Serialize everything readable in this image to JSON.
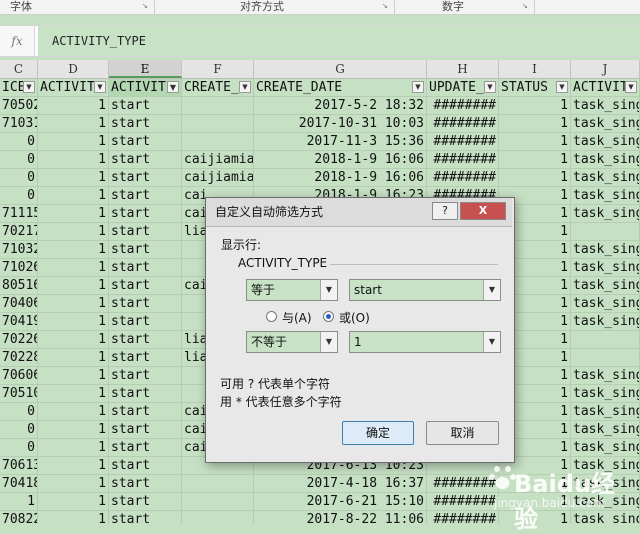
{
  "ribbon": {
    "font_group": "字体",
    "align_group": "对齐方式",
    "number_group": "数字"
  },
  "formula_bar": {
    "fx_label": "fx",
    "content": "ACTIVITY_TYPE"
  },
  "columns": [
    "C",
    "D",
    "E",
    "F",
    "G",
    "H",
    "I",
    "J"
  ],
  "selected_column": "E",
  "header_row": [
    "ICE",
    "ACTIVIT",
    "ACTIVIT",
    "CREATE_",
    "CREATE_DATE",
    "UPDATE_",
    "STATUS",
    "ACTIVIT"
  ],
  "rows": [
    [
      "70502",
      "1",
      "start",
      "",
      "2017-5-2 18:32",
      "########",
      "1",
      "task_sing"
    ],
    [
      "71031",
      "1",
      "start",
      "",
      "2017-10-31 10:03",
      "########",
      "1",
      "task_sing"
    ],
    [
      "0",
      "1",
      "start",
      "",
      "2017-11-3 15:36",
      "########",
      "1",
      "task_sing"
    ],
    [
      "0",
      "1",
      "start",
      "caijiamia",
      "2018-1-9 16:06",
      "########",
      "1",
      "task_sing"
    ],
    [
      "0",
      "1",
      "start",
      "caijiamia",
      "2018-1-9 16:06",
      "########",
      "1",
      "task_sing"
    ],
    [
      "0",
      "1",
      "start",
      "cai",
      "2018-1-9 16:23",
      "########",
      "1",
      "task_sing"
    ],
    [
      "71115",
      "1",
      "start",
      "cai",
      "",
      "",
      "1",
      "task_sing"
    ],
    [
      "70217",
      "1",
      "start",
      "lia",
      "",
      "",
      "1",
      ""
    ],
    [
      "71032",
      "1",
      "start",
      "",
      "",
      "",
      "1",
      "task_sing"
    ],
    [
      "71026",
      "1",
      "start",
      "",
      "",
      "",
      "1",
      "task_sing"
    ],
    [
      "80516",
      "1",
      "start",
      "cai",
      "",
      "",
      "1",
      "task_sing"
    ],
    [
      "70406",
      "1",
      "start",
      "",
      "",
      "",
      "1",
      "task_sing"
    ],
    [
      "70419",
      "1",
      "start",
      "",
      "",
      "",
      "1",
      "task_sing"
    ],
    [
      "70226",
      "1",
      "start",
      "lia",
      "",
      "",
      "1",
      ""
    ],
    [
      "70228",
      "1",
      "start",
      "lia",
      "",
      "",
      "1",
      ""
    ],
    [
      "70606",
      "1",
      "start",
      "",
      "",
      "",
      "1",
      "task_sing"
    ],
    [
      "70510",
      "1",
      "start",
      "",
      "",
      "",
      "1",
      "task_sing"
    ],
    [
      "0",
      "1",
      "start",
      "cai",
      "",
      "",
      "1",
      "task_sing"
    ],
    [
      "0",
      "1",
      "start",
      "cai",
      "",
      "",
      "1",
      "task_sing"
    ],
    [
      "0",
      "1",
      "start",
      "cai",
      "",
      "",
      "1",
      "task_sing"
    ],
    [
      "70613",
      "1",
      "start",
      "",
      "2017-6-13 10:23",
      "",
      "1",
      "task_sing"
    ],
    [
      "70418",
      "1",
      "start",
      "",
      "2017-4-18 16:37",
      "########",
      "1",
      "task_sing"
    ],
    [
      "1",
      "1",
      "start",
      "",
      "2017-6-21 15:10",
      "########",
      "1",
      "task_sing"
    ],
    [
      "70822",
      "1",
      "start",
      "",
      "2017-8-22 11:06",
      "########",
      "1",
      "task_sing"
    ]
  ],
  "dialog": {
    "title": "自定义自动筛选方式",
    "help_label": "?",
    "close_label": "X",
    "show_rows_label": "显示行:",
    "field_name": "ACTIVITY_TYPE",
    "condition1_operator": "等于",
    "condition1_value": "start",
    "and_label": "与(A)",
    "or_label": "或(O)",
    "logic_selected": "or",
    "condition2_operator": "不等于",
    "condition2_value": "1",
    "hint1": "可用 ? 代表单个字符",
    "hint2": "用 * 代表任意多个字符",
    "ok_label": "确定",
    "cancel_label": "取消"
  },
  "watermark": {
    "brand": "Baidu经验",
    "url": "jingyan.baidu.com"
  },
  "colors": {
    "sheet_fill": "#c6e0c4",
    "dialog_bg": "#e8e8e8",
    "close_red": "#c75050",
    "radio_blue": "#2b62c8"
  }
}
